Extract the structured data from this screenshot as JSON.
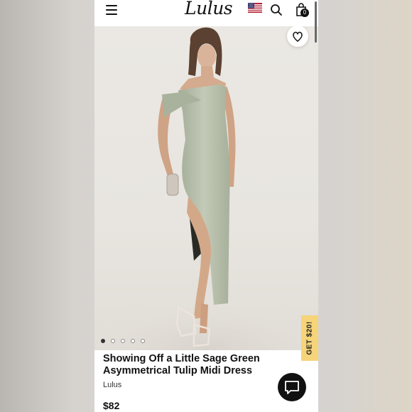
{
  "header": {
    "menu_icon": "hamburger-icon",
    "logo_text": "Lulus",
    "flag_icon": "us-flag-icon",
    "search_icon": "search-icon",
    "bag_icon": "shopping-bag-icon",
    "bag_count": "0"
  },
  "gallery": {
    "wishlist_icon": "heart-icon",
    "image_alt": "Model wearing sage green asymmetrical tulip midi dress",
    "dot_count": 5,
    "active_dot": 1
  },
  "promo": {
    "label": "GET $20!"
  },
  "product": {
    "title": "Showing Off a Little Sage Green Asymmetrical Tulip Midi Dress",
    "brand": "Lulus",
    "price": "$82"
  },
  "chat": {
    "icon": "chat-bubble-icon"
  },
  "colors": {
    "dress": "#b8c0ad",
    "promo": "#f6d479",
    "text": "#111111"
  }
}
